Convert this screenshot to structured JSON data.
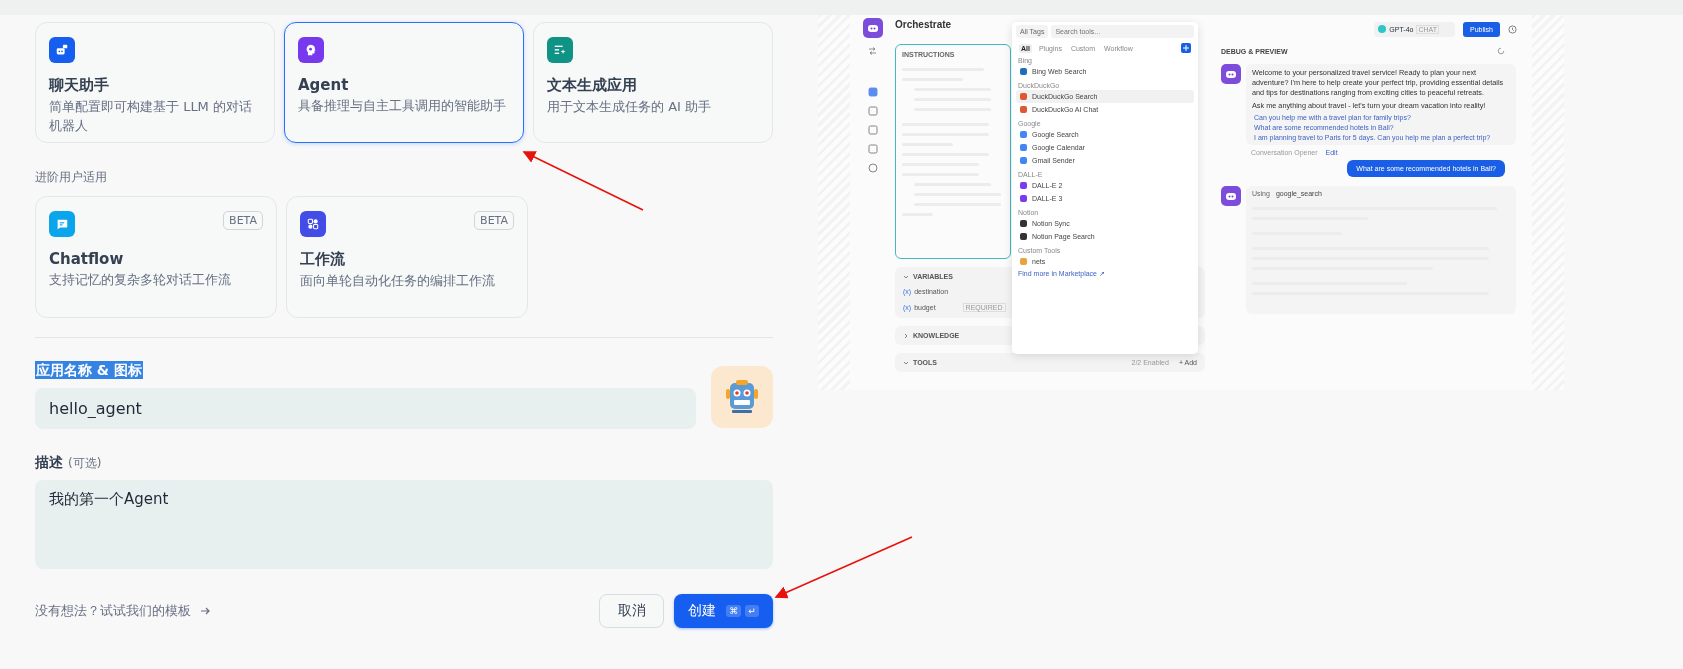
{
  "app_types": [
    {
      "title": "聊天助手",
      "description": "简单配置即可构建基于 LLM 的对话机器人",
      "selected": false
    },
    {
      "title": "Agent",
      "description": "具备推理与自主工具调用的智能助手",
      "selected": true
    },
    {
      "title": "文本生成应用",
      "description": "用于文本生成任务的 AI 助手",
      "selected": false
    }
  ],
  "advanced": {
    "label": "进阶用户适用",
    "types": [
      {
        "title": "Chatflow",
        "description": "支持记忆的复杂多轮对话工作流",
        "badge": "BETA",
        "selected": false
      },
      {
        "title": "工作流",
        "description": "面向单轮自动化任务的编排工作流",
        "badge": "BETA",
        "selected": false
      }
    ]
  },
  "name_field": {
    "label": "应用名称 & 图标",
    "value": "hello_agent"
  },
  "description_field": {
    "label": "描述",
    "hint": "(可选)",
    "value": "我的第一个Agent"
  },
  "template_link": "没有想法？试试我们的模板",
  "cancel_button": "取消",
  "create_button": {
    "label": "创建",
    "keys": [
      "⌘",
      "↵"
    ]
  },
  "preview": {
    "title": "Orchestrate",
    "instructions_label": "INSTRUCTIONS",
    "sections": [
      {
        "label": "VARIABLES",
        "expanded": true,
        "items": [
          {
            "symbol": "(x)",
            "name": "destination"
          },
          {
            "symbol": "(x)",
            "name": "budget",
            "badge": "REQUIRED"
          }
        ]
      },
      {
        "label": "KNOWLEDGE",
        "expanded": false
      },
      {
        "label": "TOOLS",
        "expanded": true,
        "count": "2/2 Enabled",
        "action": "+ Add"
      }
    ],
    "tool_picker": {
      "filter": "All Tags",
      "search_placeholder": "Search tools...",
      "tabs": [
        {
          "label": "All",
          "selected": true
        },
        {
          "label": "Plugins",
          "selected": false
        },
        {
          "label": "Custom",
          "selected": false
        },
        {
          "label": "Workflow",
          "selected": false
        }
      ],
      "groups": [
        {
          "name": "Bing",
          "tools": [
            {
              "name": "Bing Web Search",
              "selected": false
            }
          ]
        },
        {
          "name": "DuckDuckGo",
          "tools": [
            {
              "name": "DuckDuckGo Search",
              "selected": true
            },
            {
              "name": "DuckDuckGo AI Chat",
              "selected": false
            }
          ]
        },
        {
          "name": "Google",
          "tools": [
            {
              "name": "Google Search",
              "selected": false
            },
            {
              "name": "Google Calendar",
              "selected": false
            },
            {
              "name": "Gmail Sender",
              "selected": false
            }
          ]
        },
        {
          "name": "DALL-E",
          "tools": [
            {
              "name": "DALL-E 2",
              "selected": false
            },
            {
              "name": "DALL-E 3",
              "selected": false
            }
          ]
        },
        {
          "name": "Notion",
          "tools": [
            {
              "name": "Notion Sync",
              "selected": false
            },
            {
              "name": "Notion Page Search",
              "selected": false
            }
          ]
        },
        {
          "name": "Custom Tools",
          "tools": [
            {
              "name": "nets",
              "selected": false
            }
          ]
        }
      ],
      "footer": "Find more in Marketplace ↗"
    },
    "model": {
      "name": "GPT-4o",
      "tag": "CHAT"
    },
    "publish": "Publish",
    "debug_title": "DEBUG & PREVIEW",
    "messages": [
      {
        "kind": "bot",
        "paragraphs": [
          "Welcome to your personalized travel service! Ready to plan your next adventure? I'm here to help create your perfect trip, providing essential details and tips for destinations ranging from exciting cities to peaceful retreats.",
          "Ask me anything about travel - let's turn your dream vacation into reality!"
        ],
        "suggestions": [
          "Can you help me with a travel plan for family trips?",
          "What are some recommended hotels in Bali?",
          "I am planning travel to Paris for 5 days. Can you help me plan a perfect trip?"
        ],
        "footer": "Conversation Opener",
        "footer_action": "Edit"
      },
      {
        "kind": "user",
        "text": "What are some recommended hotels in Bali?"
      },
      {
        "kind": "tool",
        "using": "Using",
        "tool": "google_search"
      }
    ]
  }
}
